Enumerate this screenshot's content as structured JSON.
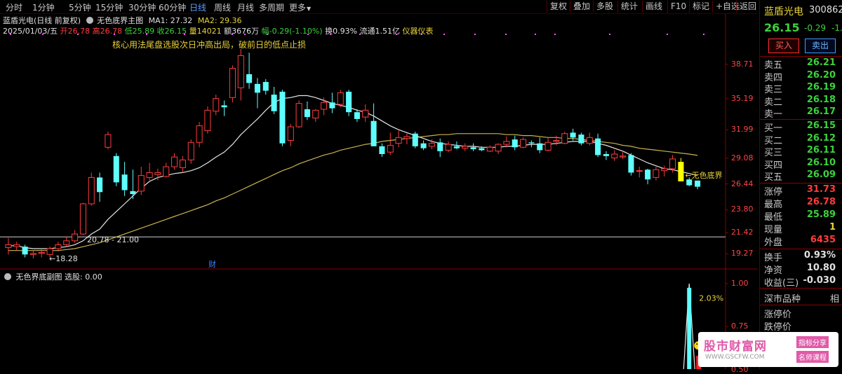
{
  "toolbar": {
    "periods": [
      "分时",
      "1分钟",
      "5分钟",
      "15分钟",
      "30分钟",
      "60分钟",
      "日线",
      "周线",
      "月线",
      "多周期",
      "更多"
    ],
    "active_period": "日线",
    "more_arrow": "▼",
    "tools": [
      "复权",
      "叠加",
      "多股",
      "统计",
      "画线",
      "F10",
      "标记",
      "+自选",
      "返回"
    ]
  },
  "main_header": {
    "stock_name": "蓝盾光电(日线 前复权)",
    "indicator_name": "无色底界主图",
    "ma1_label": "MA1: 27.32",
    "ma2_label": "MA2: 29.36"
  },
  "info_line": {
    "date": "2025/01/03/五",
    "open": "开26.78",
    "high": "高26.78",
    "low": "低25.89",
    "close": "收26.15",
    "volume": "量14021",
    "amount": "额3676万",
    "change": "幅-0.29(-1.10%)",
    "turnover": "换0.93%",
    "float": "流通1.51亿",
    "industry": "仪器仪表"
  },
  "annotation": "核心用法尾盘选股次日冲高出局，破前日的低点止损",
  "chart_labels": {
    "low_mark": "18.28",
    "range_mark": "20.78 - 21.00",
    "signal_mark": "无色底界",
    "finance_mark": "财",
    "sub_pct": "2.03%"
  },
  "price_axis": [
    "38.71",
    "35.19",
    "31.99",
    "29.08",
    "26.44",
    "23.80",
    "21.42",
    "19.27"
  ],
  "sub_header": {
    "name": "无色界底副图",
    "value": "选股: 0.00"
  },
  "sub_axis": [
    "1.00",
    "0.75",
    "0.50"
  ],
  "right_panel": {
    "stock_name": "蓝盾光电",
    "code": "300862",
    "price": "26.15",
    "change": "-0.29",
    "change_pct": "-1.",
    "buy_button": "买入",
    "sell_button": "卖出",
    "asks": [
      {
        "label": "卖五",
        "price": "26.21"
      },
      {
        "label": "卖四",
        "price": "26.20"
      },
      {
        "label": "卖三",
        "price": "26.19"
      },
      {
        "label": "卖二",
        "price": "26.18"
      },
      {
        "label": "卖一",
        "price": "26.17"
      }
    ],
    "bids": [
      {
        "label": "买一",
        "price": "26.15"
      },
      {
        "label": "买二",
        "price": "26.12"
      },
      {
        "label": "买三",
        "price": "26.11"
      },
      {
        "label": "买四",
        "price": "26.10"
      },
      {
        "label": "买五",
        "price": "26.09"
      }
    ],
    "stats1": [
      {
        "label": "涨停",
        "value": "31.73",
        "color": "#ff3c3c"
      },
      {
        "label": "最高",
        "value": "26.78",
        "color": "#ff3c3c"
      },
      {
        "label": "最低",
        "value": "25.89",
        "color": "#3cd23c"
      },
      {
        "label": "现量",
        "value": "1",
        "color": "#e8d23c"
      },
      {
        "label": "外盘",
        "value": "6435",
        "color": "#ff3c3c"
      }
    ],
    "stats2": [
      {
        "label": "换手",
        "value": "0.93%",
        "color": "#e0e0e0"
      },
      {
        "label": "净资",
        "value": "10.80",
        "color": "#e0e0e0"
      },
      {
        "label": "收益(三)",
        "value": "-0.030",
        "color": "#e0e0e0"
      }
    ],
    "market": "深市品种",
    "market_right": "相",
    "limit_labels": [
      "涨停价",
      "跌停价"
    ]
  },
  "watermark": {
    "title": "股市财富网",
    "url": "WWW.GSCFW.COM",
    "tag1": "指标分享",
    "tag2": "名师课程"
  },
  "colors": {
    "up": "#ff3c3c",
    "down": "#5fffff",
    "ma_white": "#e6e6e6",
    "ma_yellow": "#c8b450",
    "signal": "#ffff00"
  },
  "chart_data": {
    "type": "candlestick",
    "ylim": [
      18.0,
      41.0
    ],
    "candles": [
      {
        "o": 19.9,
        "h": 20.9,
        "l": 19.2,
        "c": 20.2
      },
      {
        "o": 20.0,
        "h": 20.5,
        "l": 19.6,
        "c": 20.2
      },
      {
        "o": 20.0,
        "h": 20.2,
        "l": 18.9,
        "c": 19.2
      },
      {
        "o": 19.2,
        "h": 19.6,
        "l": 18.8,
        "c": 19.3
      },
      {
        "o": 19.3,
        "h": 19.8,
        "l": 18.9,
        "c": 19.4
      },
      {
        "o": 19.2,
        "h": 20.0,
        "l": 18.9,
        "c": 19.8
      },
      {
        "o": 19.8,
        "h": 20.5,
        "l": 19.5,
        "c": 20.2
      },
      {
        "o": 20.2,
        "h": 21.0,
        "l": 20.0,
        "c": 20.6
      },
      {
        "o": 20.6,
        "h": 21.7,
        "l": 20.4,
        "c": 21.3
      },
      {
        "o": 21.3,
        "h": 24.5,
        "l": 21.2,
        "c": 24.4
      },
      {
        "o": 24.4,
        "h": 27.6,
        "l": 24.2,
        "c": 27.1
      },
      {
        "o": 27.1,
        "h": 27.6,
        "l": 24.6,
        "c": 25.6
      },
      {
        "o": 30.2,
        "h": 31.8,
        "l": 30.0,
        "c": 31.5
      },
      {
        "o": 29.3,
        "h": 29.6,
        "l": 26.2,
        "c": 26.6
      },
      {
        "o": 27.4,
        "h": 28.7,
        "l": 25.2,
        "c": 25.8
      },
      {
        "o": 25.7,
        "h": 27.9,
        "l": 24.9,
        "c": 25.4
      },
      {
        "o": 25.7,
        "h": 28.2,
        "l": 25.3,
        "c": 27.3
      },
      {
        "o": 27.1,
        "h": 28.6,
        "l": 26.8,
        "c": 27.6
      },
      {
        "o": 27.4,
        "h": 28.0,
        "l": 26.8,
        "c": 27.6
      },
      {
        "o": 27.2,
        "h": 28.6,
        "l": 27.1,
        "c": 28.2
      },
      {
        "o": 28.2,
        "h": 29.6,
        "l": 27.9,
        "c": 29.2
      },
      {
        "o": 28.1,
        "h": 29.3,
        "l": 27.6,
        "c": 28.9
      },
      {
        "o": 28.9,
        "h": 31.0,
        "l": 28.5,
        "c": 30.7
      },
      {
        "o": 30.7,
        "h": 32.8,
        "l": 30.2,
        "c": 32.4
      },
      {
        "o": 31.9,
        "h": 34.4,
        "l": 31.6,
        "c": 34.0
      },
      {
        "o": 33.9,
        "h": 35.6,
        "l": 33.5,
        "c": 35.2
      },
      {
        "o": 34.5,
        "h": 35.0,
        "l": 33.4,
        "c": 34.3
      },
      {
        "o": 35.3,
        "h": 38.6,
        "l": 34.8,
        "c": 38.3
      },
      {
        "o": 36.3,
        "h": 40.3,
        "l": 35.0,
        "c": 39.6
      },
      {
        "o": 37.7,
        "h": 39.9,
        "l": 36.2,
        "c": 36.8
      },
      {
        "o": 36.7,
        "h": 37.3,
        "l": 34.2,
        "c": 35.8
      },
      {
        "o": 36.9,
        "h": 37.2,
        "l": 35.6,
        "c": 36.0
      },
      {
        "o": 35.6,
        "h": 36.4,
        "l": 33.6,
        "c": 33.9
      },
      {
        "o": 35.9,
        "h": 36.1,
        "l": 30.3,
        "c": 30.6
      },
      {
        "o": 30.9,
        "h": 32.6,
        "l": 30.3,
        "c": 32.3
      },
      {
        "o": 32.3,
        "h": 35.0,
        "l": 32.2,
        "c": 34.7
      },
      {
        "o": 34.1,
        "h": 34.9,
        "l": 33.0,
        "c": 33.3
      },
      {
        "o": 33.2,
        "h": 34.1,
        "l": 32.8,
        "c": 34.0
      },
      {
        "o": 34.1,
        "h": 35.3,
        "l": 33.5,
        "c": 34.8
      },
      {
        "o": 34.8,
        "h": 35.8,
        "l": 33.7,
        "c": 34.2
      },
      {
        "o": 34.6,
        "h": 36.1,
        "l": 34.3,
        "c": 35.8
      },
      {
        "o": 35.9,
        "h": 36.1,
        "l": 33.4,
        "c": 33.8
      },
      {
        "o": 33.8,
        "h": 34.1,
        "l": 32.8,
        "c": 33.1
      },
      {
        "o": 33.3,
        "h": 34.6,
        "l": 32.8,
        "c": 34.0
      },
      {
        "o": 32.9,
        "h": 34.7,
        "l": 30.7,
        "c": 30.3
      },
      {
        "o": 30.3,
        "h": 30.6,
        "l": 29.2,
        "c": 29.5
      },
      {
        "o": 29.7,
        "h": 31.7,
        "l": 29.4,
        "c": 30.4
      },
      {
        "o": 30.6,
        "h": 31.9,
        "l": 30.2,
        "c": 31.2
      },
      {
        "o": 31.1,
        "h": 31.6,
        "l": 30.5,
        "c": 31.3
      },
      {
        "o": 31.6,
        "h": 31.8,
        "l": 30.1,
        "c": 30.3
      },
      {
        "o": 30.6,
        "h": 30.9,
        "l": 29.9,
        "c": 30.1
      },
      {
        "o": 30.3,
        "h": 31.0,
        "l": 30.0,
        "c": 30.6
      },
      {
        "o": 30.7,
        "h": 31.1,
        "l": 29.2,
        "c": 29.8
      },
      {
        "o": 29.9,
        "h": 30.8,
        "l": 29.7,
        "c": 30.5
      },
      {
        "o": 30.3,
        "h": 30.8,
        "l": 30.0,
        "c": 30.1
      },
      {
        "o": 30.1,
        "h": 30.6,
        "l": 29.8,
        "c": 30.3
      },
      {
        "o": 30.2,
        "h": 30.6,
        "l": 29.8,
        "c": 30.0
      },
      {
        "o": 30.1,
        "h": 30.3,
        "l": 29.8,
        "c": 29.9
      },
      {
        "o": 29.8,
        "h": 30.4,
        "l": 29.7,
        "c": 30.2
      },
      {
        "o": 29.8,
        "h": 30.6,
        "l": 29.5,
        "c": 30.5
      },
      {
        "o": 30.5,
        "h": 31.3,
        "l": 30.2,
        "c": 30.8
      },
      {
        "o": 31.0,
        "h": 31.4,
        "l": 29.9,
        "c": 30.2
      },
      {
        "o": 30.2,
        "h": 31.2,
        "l": 30.1,
        "c": 31.0
      },
      {
        "o": 30.7,
        "h": 30.9,
        "l": 30.2,
        "c": 30.6
      },
      {
        "o": 30.6,
        "h": 31.2,
        "l": 29.6,
        "c": 29.9
      },
      {
        "o": 29.9,
        "h": 31.2,
        "l": 29.8,
        "c": 30.7
      },
      {
        "o": 30.8,
        "h": 31.4,
        "l": 30.4,
        "c": 30.9
      },
      {
        "o": 30.6,
        "h": 31.8,
        "l": 30.5,
        "c": 31.6
      },
      {
        "o": 31.7,
        "h": 32.1,
        "l": 30.9,
        "c": 31.2
      },
      {
        "o": 31.5,
        "h": 31.7,
        "l": 30.4,
        "c": 30.6
      },
      {
        "o": 30.6,
        "h": 31.7,
        "l": 30.4,
        "c": 31.2
      },
      {
        "o": 31.1,
        "h": 31.6,
        "l": 29.2,
        "c": 29.4
      },
      {
        "o": 29.5,
        "h": 29.8,
        "l": 28.9,
        "c": 29.3
      },
      {
        "o": 29.1,
        "h": 29.9,
        "l": 28.8,
        "c": 29.5
      },
      {
        "o": 29.2,
        "h": 29.7,
        "l": 29.0,
        "c": 29.3
      },
      {
        "o": 29.4,
        "h": 29.6,
        "l": 27.3,
        "c": 27.6
      },
      {
        "o": 27.8,
        "h": 28.2,
        "l": 27.1,
        "c": 27.8
      },
      {
        "o": 27.9,
        "h": 28.0,
        "l": 26.4,
        "c": 26.9
      },
      {
        "o": 27.1,
        "h": 28.2,
        "l": 26.8,
        "c": 27.9
      },
      {
        "o": 27.8,
        "h": 28.3,
        "l": 27.2,
        "c": 28.0
      },
      {
        "o": 28.0,
        "h": 29.4,
        "l": 27.6,
        "c": 29.0
      },
      {
        "o": 28.7,
        "h": 29.1,
        "l": 26.7,
        "c": 26.7
      },
      {
        "o": 26.9,
        "h": 27.1,
        "l": 26.2,
        "c": 26.3
      },
      {
        "o": 26.78,
        "h": 26.78,
        "l": 25.89,
        "c": 26.15
      }
    ],
    "ma1": [
      20.1,
      20.1,
      19.9,
      19.8,
      19.8,
      19.8,
      19.9,
      20.0,
      20.2,
      20.6,
      21.3,
      21.8,
      22.8,
      23.6,
      24.4,
      25.2,
      26.0,
      26.7,
      27.1,
      27.3,
      27.5,
      27.6,
      27.8,
      28.1,
      28.6,
      29.2,
      29.7,
      30.5,
      31.5,
      32.3,
      33.1,
      34.0,
      34.8,
      35.2,
      35.3,
      35.5,
      35.5,
      35.3,
      35.0,
      34.7,
      34.5,
      34.3,
      34.0,
      33.8,
      33.4,
      32.9,
      32.4,
      32.0,
      31.7,
      31.4,
      31.1,
      30.8,
      30.6,
      30.5,
      30.4,
      30.3,
      30.3,
      30.2,
      30.2,
      30.2,
      30.3,
      30.3,
      30.4,
      30.5,
      30.5,
      30.5,
      30.6,
      30.7,
      30.8,
      30.8,
      30.8,
      30.6,
      30.4,
      30.1,
      29.8,
      29.4,
      29.0,
      28.6,
      28.3,
      28.0,
      27.9,
      27.7,
      27.5,
      27.32
    ],
    "ma2": [
      19.6,
      19.6,
      19.6,
      19.6,
      19.6,
      19.6,
      19.6,
      19.7,
      19.8,
      20.0,
      20.2,
      20.4,
      20.7,
      21.0,
      21.3,
      21.6,
      21.9,
      22.2,
      22.5,
      22.8,
      23.1,
      23.4,
      23.7,
      24.0,
      24.3,
      24.7,
      25.0,
      25.4,
      25.8,
      26.2,
      26.6,
      27.0,
      27.4,
      27.8,
      28.1,
      28.5,
      28.8,
      29.1,
      29.4,
      29.6,
      29.9,
      30.1,
      30.3,
      30.5,
      30.6,
      30.8,
      30.9,
      31.0,
      31.1,
      31.2,
      31.3,
      31.4,
      31.5,
      31.5,
      31.6,
      31.6,
      31.6,
      31.6,
      31.6,
      31.6,
      31.5,
      31.5,
      31.4,
      31.4,
      31.3,
      31.2,
      31.2,
      31.1,
      31.1,
      31.0,
      30.9,
      30.8,
      30.7,
      30.6,
      30.4,
      30.3,
      30.1,
      30.0,
      29.9,
      29.8,
      29.7,
      29.6,
      29.5,
      29.36
    ],
    "signal_index": 81,
    "sub_signal_index": 82
  }
}
